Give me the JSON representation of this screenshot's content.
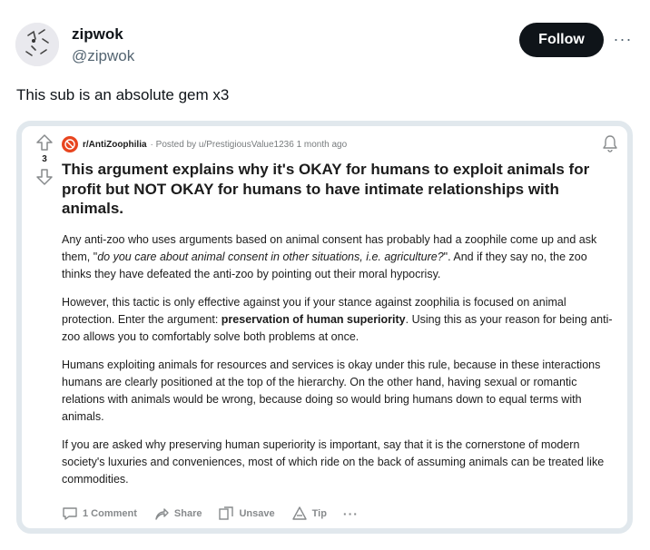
{
  "tweet": {
    "display_name": "zipwok",
    "handle": "@zipwok",
    "follow_label": "Follow",
    "more_icon": "more-horizontal-icon",
    "text": "This sub is an absolute gem x3"
  },
  "post": {
    "vote_count": "3",
    "subreddit": "r/AntiZoophilia",
    "posted_by": "· Posted by u/PrestigiousValue1236 1 month ago",
    "title": "This argument explains why it's OKAY for humans to exploit animals for profit but NOT OKAY for humans to have intimate relationships with animals.",
    "paragraphs": {
      "p1_a": "Any anti-zoo who uses arguments based on animal consent has probably had a zoophile come up and ask them, \"",
      "p1_em": "do you care about animal consent in other situations, i.e. agriculture?",
      "p1_b": "\". And if they say no, the zoo thinks they have defeated the anti-zoo by pointing out their moral hypocrisy.",
      "p2_a": "However, this tactic is only effective against you if your stance against zoophilia is focused on animal protection. Enter the argument: ",
      "p2_strong": "preservation of human superiority",
      "p2_b": ". Using this as your reason for being anti-zoo allows you to comfortably solve both problems at once.",
      "p3": "Humans exploiting animals for resources and services is okay under this rule, because in these interactions humans are clearly positioned at the top of the hierarchy. On the other hand, having sexual or romantic relations with animals would be wrong, because doing so would bring humans down to equal terms with animals.",
      "p4": "If you are asked why preserving human superiority is important, say that it is the cornerstone of modern society's luxuries and conveniences, most of which ride on the back of assuming animals can be treated like commodities."
    },
    "actions": {
      "comment": "1 Comment",
      "share": "Share",
      "unsave": "Unsave",
      "tip": "Tip",
      "more": "···"
    }
  },
  "colors": {
    "follow_bg": "#0f1419",
    "subreddit_icon": "#e8451f",
    "card_border": "#e1e8ed"
  }
}
